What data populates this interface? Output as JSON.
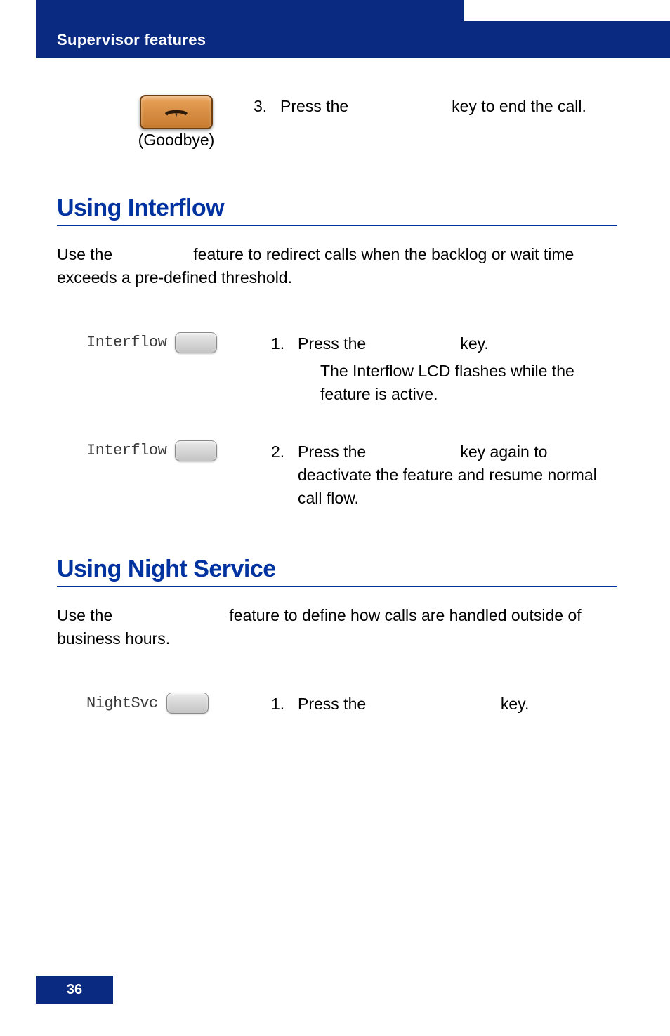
{
  "header": {
    "title": "Supervisor features"
  },
  "goodbye": {
    "caption": "(Goodbye)",
    "step_num": "3.",
    "step_text": "Press the                       key to end the call."
  },
  "interflow": {
    "title": "Using Interflow",
    "intro": "Use the                  feature to redirect calls when the backlog or wait time exceeds a pre-defined threshold.",
    "lcd1": "Interflow",
    "lcd2": "Interflow",
    "step1_num": "1.",
    "step1_text": "Press the                     key.",
    "step1_note": "The Interflow LCD flashes while the feature is active.",
    "step2_num": "2.",
    "step2_text": "Press the                     key again to deactivate the feature and resume normal call flow."
  },
  "night": {
    "title": "Using Night Service",
    "intro": "Use the                          feature to define how calls are handled outside of business hours.",
    "lcd1": "NightSvc",
    "step1_num": "1.",
    "step1_text": "Press the                              key."
  },
  "page_number": "36"
}
